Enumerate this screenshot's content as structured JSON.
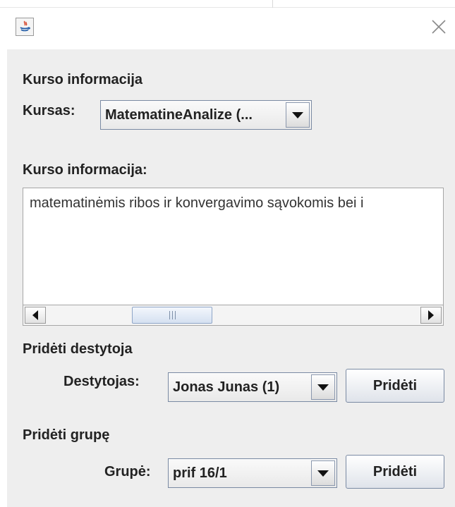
{
  "window": {
    "icon": "java-icon",
    "close_icon": "close-icon"
  },
  "course_info": {
    "section_title": "Kurso informacija",
    "course_label": "Kursas:",
    "course_selected": "MatematineAnalize (...",
    "info_label": "Kurso informacija:",
    "info_text": "matematinėmis ribos ir konvergavimo sąvokomis bei i"
  },
  "add_teacher": {
    "section_title": "Pridėti destytoja",
    "teacher_label": "Destytojas:",
    "teacher_selected": "Jonas Junas (1)",
    "button_label": "Pridėti"
  },
  "add_group": {
    "section_title": "Pridėti grupę",
    "group_label": "Grupė:",
    "group_selected": "prif 16/1",
    "button_label": "Pridėti"
  }
}
